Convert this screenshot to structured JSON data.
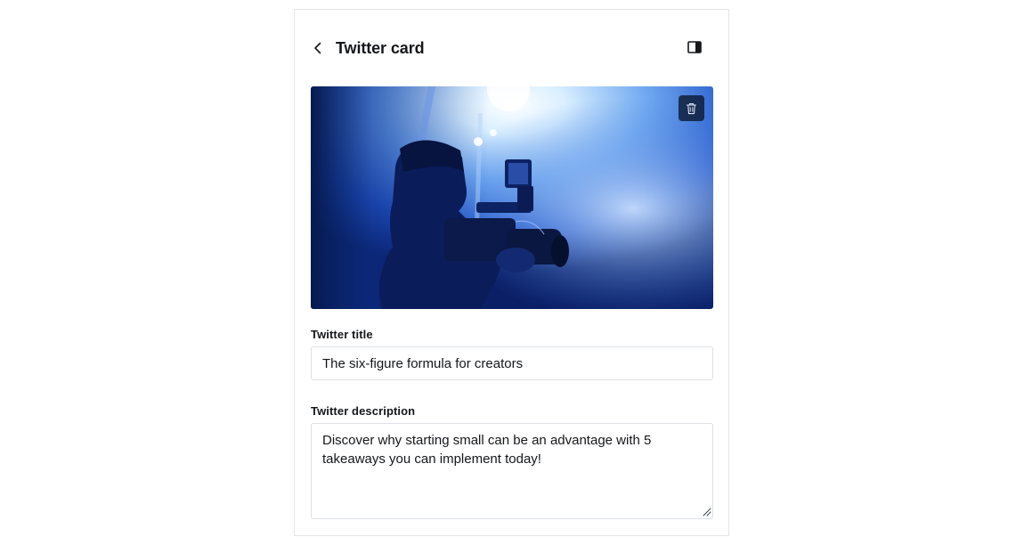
{
  "header": {
    "title": "Twitter card",
    "back_icon": "chevron-left-icon",
    "sidebar_icon": "sidebar-toggle-icon"
  },
  "image": {
    "description_icon": "photo",
    "delete_icon": "trash-icon"
  },
  "fields": {
    "title_label": "Twitter title",
    "title_value": "The six-figure formula for creators",
    "description_label": "Twitter description",
    "description_value": "Discover why starting small can be an advantage with 5 takeaways you can implement today!"
  },
  "colors": {
    "text": "#15171a",
    "border": "#dde1e5",
    "panel_border": "#e3e5e8",
    "image_blue": "#1a4fc4"
  }
}
